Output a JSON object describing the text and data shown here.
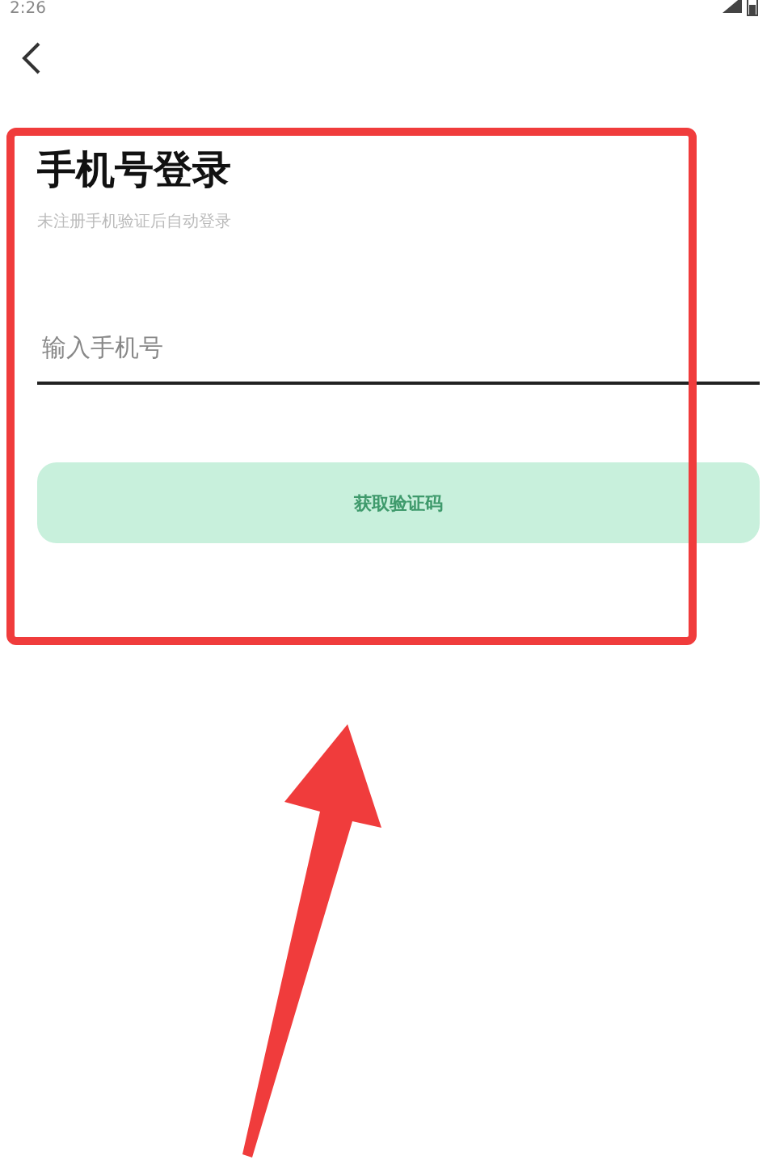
{
  "status_bar": {
    "time": "2:26"
  },
  "login": {
    "title": "手机号登录",
    "subtitle": "未注册手机验证后自动登录",
    "phone_field": {
      "placeholder": "输入手机号"
    },
    "button": {
      "label": "获取验证码",
      "disabled": true
    }
  }
}
